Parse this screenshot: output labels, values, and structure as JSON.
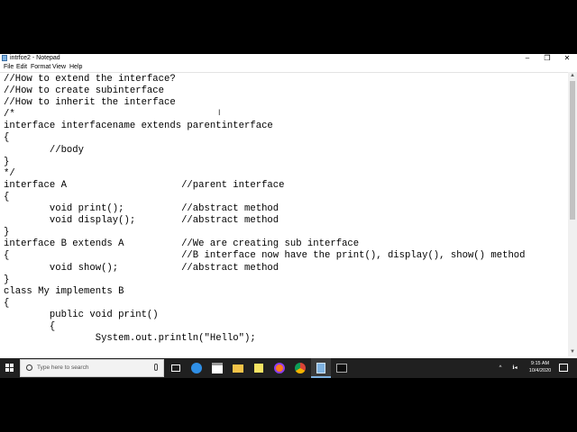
{
  "window": {
    "title": "intrfce2 - Notepad",
    "minimize_glyph": "–",
    "maximize_glyph": "❐",
    "close_glyph": "✕"
  },
  "menu": [
    "File",
    "Edit",
    "Format",
    "View",
    "Help"
  ],
  "editor": {
    "lines": [
      "//How to extend the interface?",
      "//How to create subinterface",
      "//How to inherit the interface",
      "/*",
      "interface interfacename extends parentinterface",
      "{",
      "        //body",
      "}",
      "*/",
      "interface A                    //parent interface",
      "{",
      "        void print();          //abstract method",
      "        void display();        //abstract method",
      "}",
      "interface B extends A          //We are creating sub interface",
      "{                              //B interface now have the print(), display(), show() method",
      "        void show();           //abstract method",
      "}",
      "class My implements B",
      "{",
      "        public void print()",
      "        {",
      "                System.out.println(\"Hello\");"
    ]
  },
  "taskbar": {
    "search_placeholder": "Type here to search",
    "icons": [
      "task-view-icon",
      "edge-icon",
      "store-icon",
      "file-explorer-icon",
      "sticky-notes-icon",
      "firefox-icon",
      "chrome-icon",
      "notepad-icon",
      "cmd-icon"
    ],
    "tray_chevron": "^",
    "tray_status": "ℹ◂",
    "clock_time": "9:15 AM",
    "clock_date": "10/4/2020"
  },
  "colors": {
    "taskbar": "#202020",
    "accent": "#7fb2e0",
    "edge": "#2f8fe6",
    "firefox": "#ff7a1a",
    "chrome_red": "#db4437",
    "chrome_yellow": "#f4b400",
    "chrome_green": "#0f9d58",
    "folder": "#f3c348",
    "sticky": "#f7e463"
  }
}
